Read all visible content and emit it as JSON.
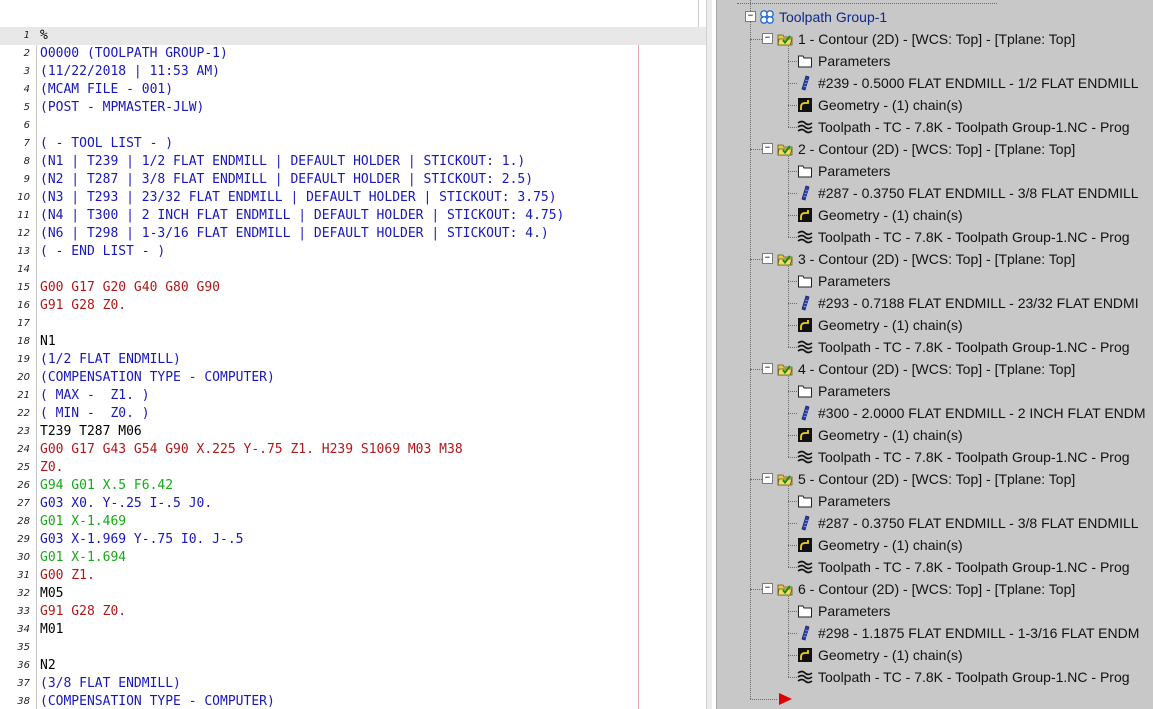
{
  "editor": {
    "lines": [
      {
        "n": "1",
        "text": "%",
        "color": "black"
      },
      {
        "n": "2",
        "text": "O0000 (TOOLPATH GROUP-1)",
        "color": "blue"
      },
      {
        "n": "3",
        "text": "(11/22/2018 | 11:53 AM)",
        "color": "blue"
      },
      {
        "n": "4",
        "text": "(MCAM FILE - 001)",
        "color": "blue"
      },
      {
        "n": "5",
        "text": "(POST - MPMASTER-JLW)",
        "color": "blue"
      },
      {
        "n": "6",
        "text": "",
        "color": "black"
      },
      {
        "n": "7",
        "text": "( - TOOL LIST - )",
        "color": "blue"
      },
      {
        "n": "8",
        "text": "(N1 | T239 | 1/2 FLAT ENDMILL | DEFAULT HOLDER | STICKOUT: 1.)",
        "color": "blue"
      },
      {
        "n": "9",
        "text": "(N2 | T287 | 3/8 FLAT ENDMILL | DEFAULT HOLDER | STICKOUT: 2.5)",
        "color": "blue"
      },
      {
        "n": "10",
        "text": "(N3 | T293 | 23/32 FLAT ENDMILL | DEFAULT HOLDER | STICKOUT: 3.75)",
        "color": "blue"
      },
      {
        "n": "11",
        "text": "(N4 | T300 | 2 INCH FLAT ENDMILL | DEFAULT HOLDER | STICKOUT: 4.75)",
        "color": "blue"
      },
      {
        "n": "12",
        "text": "(N6 | T298 | 1-3/16 FLAT ENDMILL | DEFAULT HOLDER | STICKOUT: 4.)",
        "color": "blue"
      },
      {
        "n": "13",
        "text": "( - END LIST - )",
        "color": "blue"
      },
      {
        "n": "14",
        "text": "",
        "color": "black"
      },
      {
        "n": "15",
        "text": "G00 G17 G20 G40 G80 G90",
        "color": "red"
      },
      {
        "n": "16",
        "text": "G91 G28 Z0.",
        "color": "red"
      },
      {
        "n": "17",
        "text": "",
        "color": "black"
      },
      {
        "n": "18",
        "text": "N1",
        "color": "black"
      },
      {
        "n": "19",
        "text": "(1/2 FLAT ENDMILL)",
        "color": "blue"
      },
      {
        "n": "20",
        "text": "(COMPENSATION TYPE - COMPUTER)",
        "color": "blue"
      },
      {
        "n": "21",
        "text": "( MAX -  Z1. )",
        "color": "blue"
      },
      {
        "n": "22",
        "text": "( MIN -  Z0. )",
        "color": "blue"
      },
      {
        "n": "23",
        "text": "T239 T287 M06",
        "color": "black"
      },
      {
        "n": "24",
        "text": "G00 G17 G43 G54 G90 X.225 Y-.75 Z1. H239 S1069 M03 M38",
        "color": "red"
      },
      {
        "n": "25",
        "text": "Z0.",
        "color": "red"
      },
      {
        "n": "26",
        "text": "G94 G01 X.5 F6.42",
        "color": "green"
      },
      {
        "n": "27",
        "text": "G03 X0. Y-.25 I-.5 J0.",
        "color": "blue"
      },
      {
        "n": "28",
        "text": "G01 X-1.469",
        "color": "green"
      },
      {
        "n": "29",
        "text": "G03 X-1.969 Y-.75 I0. J-.5",
        "color": "blue"
      },
      {
        "n": "30",
        "text": "G01 X-1.694",
        "color": "green"
      },
      {
        "n": "31",
        "text": "G00 Z1.",
        "color": "red"
      },
      {
        "n": "32",
        "text": "M05",
        "color": "black"
      },
      {
        "n": "33",
        "text": "G91 G28 Z0.",
        "color": "red"
      },
      {
        "n": "34",
        "text": "M01",
        "color": "black"
      },
      {
        "n": "35",
        "text": "",
        "color": "black"
      },
      {
        "n": "36",
        "text": "N2",
        "color": "black"
      },
      {
        "n": "37",
        "text": "(3/8 FLAT ENDMILL)",
        "color": "blue"
      },
      {
        "n": "38",
        "text": "(COMPENSATION TYPE - COMPUTER)",
        "color": "blue"
      }
    ]
  },
  "tree": {
    "group_label": "Toolpath Group-1",
    "operations": [
      {
        "label": "1 - Contour (2D) - [WCS: Top] - [Tplane: Top]",
        "children": [
          {
            "icon": "parameters-icon",
            "label": "Parameters"
          },
          {
            "icon": "tool-icon",
            "label": "#239 - 0.5000 FLAT ENDMILL - 1/2 FLAT ENDMILL"
          },
          {
            "icon": "geometry-icon",
            "label": "Geometry - (1) chain(s)"
          },
          {
            "icon": "toolpath-icon",
            "label": "Toolpath - TC - 7.8K - Toolpath Group-1.NC - Prog"
          }
        ]
      },
      {
        "label": "2 - Contour (2D) - [WCS: Top] - [Tplane: Top]",
        "children": [
          {
            "icon": "parameters-icon",
            "label": "Parameters"
          },
          {
            "icon": "tool-icon",
            "label": "#287 - 0.3750 FLAT ENDMILL - 3/8 FLAT ENDMILL"
          },
          {
            "icon": "geometry-icon",
            "label": "Geometry - (1) chain(s)"
          },
          {
            "icon": "toolpath-icon",
            "label": "Toolpath - TC - 7.8K - Toolpath Group-1.NC - Prog"
          }
        ]
      },
      {
        "label": "3 - Contour (2D) - [WCS: Top] - [Tplane: Top]",
        "children": [
          {
            "icon": "parameters-icon",
            "label": "Parameters"
          },
          {
            "icon": "tool-icon",
            "label": "#293 - 0.7188 FLAT ENDMILL - 23/32 FLAT ENDMI"
          },
          {
            "icon": "geometry-icon",
            "label": "Geometry - (1) chain(s)"
          },
          {
            "icon": "toolpath-icon",
            "label": "Toolpath - TC - 7.8K - Toolpath Group-1.NC - Prog"
          }
        ]
      },
      {
        "label": "4 - Contour (2D) - [WCS: Top] - [Tplane: Top]",
        "children": [
          {
            "icon": "parameters-icon",
            "label": "Parameters"
          },
          {
            "icon": "tool-icon",
            "label": "#300 - 2.0000 FLAT ENDMILL - 2 INCH FLAT ENDM"
          },
          {
            "icon": "geometry-icon",
            "label": "Geometry - (1) chain(s)"
          },
          {
            "icon": "toolpath-icon",
            "label": "Toolpath - TC - 7.8K - Toolpath Group-1.NC - Prog"
          }
        ]
      },
      {
        "label": "5 - Contour (2D) - [WCS: Top] - [Tplane: Top]",
        "children": [
          {
            "icon": "parameters-icon",
            "label": "Parameters"
          },
          {
            "icon": "tool-icon",
            "label": "#287 - 0.3750 FLAT ENDMILL - 3/8 FLAT ENDMILL"
          },
          {
            "icon": "geometry-icon",
            "label": "Geometry - (1) chain(s)"
          },
          {
            "icon": "toolpath-icon",
            "label": "Toolpath - TC - 7.8K - Toolpath Group-1.NC - Prog"
          }
        ]
      },
      {
        "label": "6 - Contour (2D) - [WCS: Top] - [Tplane: Top]",
        "children": [
          {
            "icon": "parameters-icon",
            "label": "Parameters"
          },
          {
            "icon": "tool-icon",
            "label": "#298 - 1.1875 FLAT ENDMILL - 1-3/16 FLAT ENDM"
          },
          {
            "icon": "geometry-icon",
            "label": "Geometry - (1) chain(s)"
          },
          {
            "icon": "toolpath-icon",
            "label": "Toolpath - TC - 7.8K - Toolpath Group-1.NC - Prog"
          }
        ]
      }
    ],
    "insert_arrow_icon": "insert-arrow-icon"
  },
  "colors": {
    "code_black": "#000000",
    "code_blue": "#1818b8",
    "code_red": "#b01818",
    "code_green": "#18a818",
    "tree_background": "#c8c8c8",
    "insert_arrow": "#e00000"
  }
}
